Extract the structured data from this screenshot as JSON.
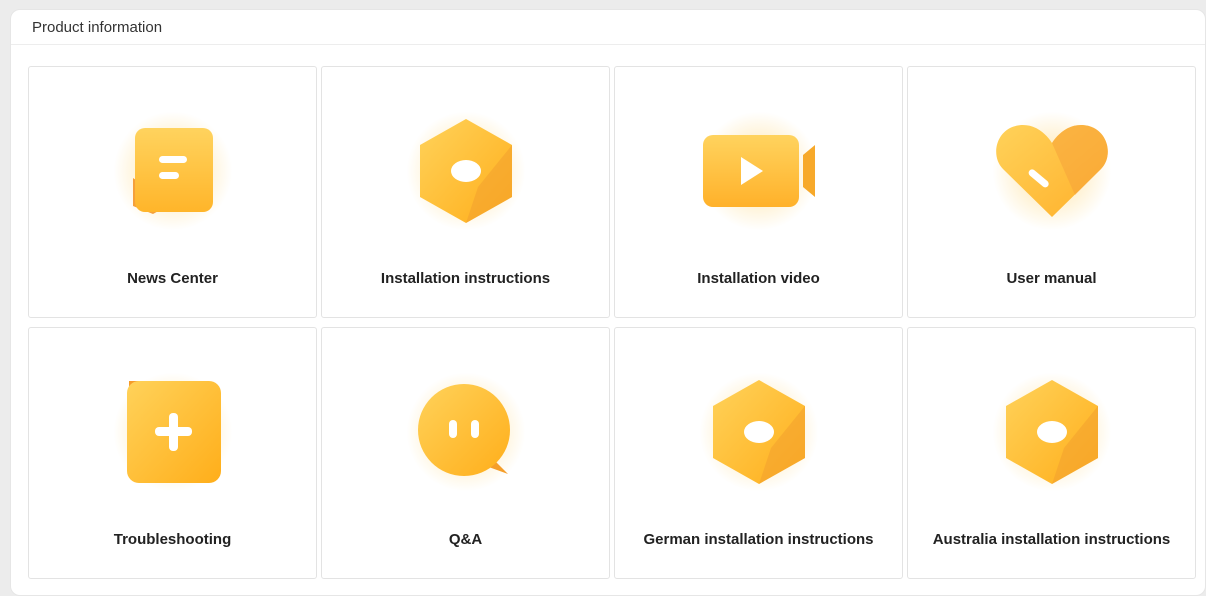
{
  "panel": {
    "title": "Product information"
  },
  "cards": [
    {
      "label": "News Center",
      "icon": "news-icon"
    },
    {
      "label": "Installation instructions",
      "icon": "hexagon-icon"
    },
    {
      "label": "Installation video",
      "icon": "video-camera-icon"
    },
    {
      "label": "User manual",
      "icon": "heart-icon"
    },
    {
      "label": "Troubleshooting",
      "icon": "plus-icon"
    },
    {
      "label": "Q&A",
      "icon": "chat-bubble-icon"
    },
    {
      "label": "German installation instructions",
      "icon": "hexagon-icon"
    },
    {
      "label": "Australia installation instructions",
      "icon": "hexagon-icon"
    }
  ],
  "colors": {
    "icon_light": "#ffd25a",
    "icon_dark": "#ffae1a",
    "icon_shadow": "#f39a2a"
  }
}
